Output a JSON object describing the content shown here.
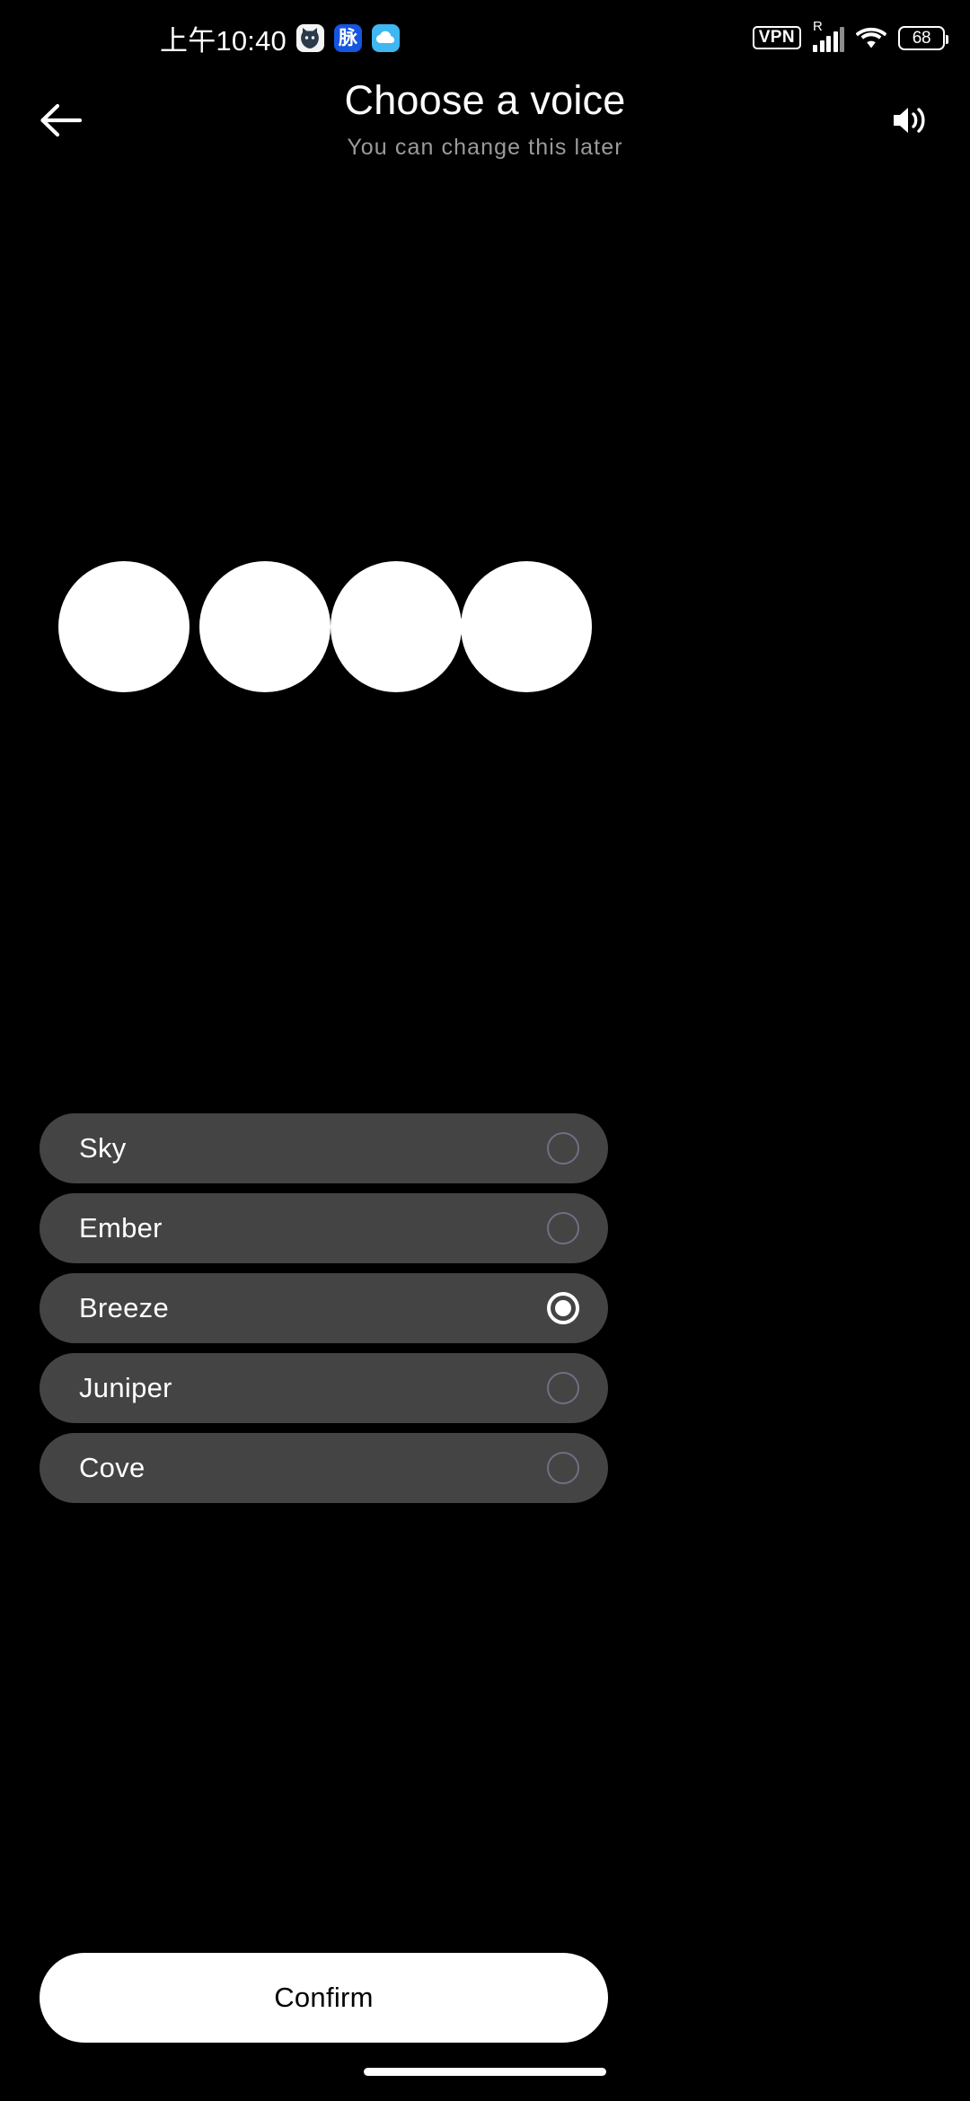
{
  "status_bar": {
    "time": "上午10:40",
    "notification_icons": [
      {
        "name": "cat-app-icon",
        "label": ""
      },
      {
        "name": "maimai-app-icon",
        "label": "脉"
      },
      {
        "name": "cloud-app-icon",
        "label": ""
      }
    ],
    "vpn_label": "VPN",
    "roaming_label": "R",
    "battery_level": "68",
    "icons": {
      "signal": "signal-bars-icon",
      "wifi": "wifi-icon",
      "battery": "battery-icon"
    }
  },
  "header": {
    "back_icon": "back-arrow-icon",
    "title": "Choose a voice",
    "subtitle": "You can change this later",
    "speaker_icon": "speaker-volume-icon"
  },
  "visualizer": {
    "orb_count": 4,
    "orb_color": "#ffffff"
  },
  "voices": [
    {
      "label": "Sky",
      "selected": false
    },
    {
      "label": "Ember",
      "selected": false
    },
    {
      "label": "Breeze",
      "selected": true
    },
    {
      "label": "Juniper",
      "selected": false
    },
    {
      "label": "Cove",
      "selected": false
    }
  ],
  "footer": {
    "confirm_label": "Confirm"
  },
  "colors": {
    "background": "#000000",
    "row_background": "#444444",
    "text_primary": "#ffffff",
    "text_secondary": "#9b9b9b",
    "radio_unselected": "#6f6f85",
    "radio_selected": "#ffffff",
    "confirm_background": "#ffffff",
    "confirm_text": "#000000"
  }
}
